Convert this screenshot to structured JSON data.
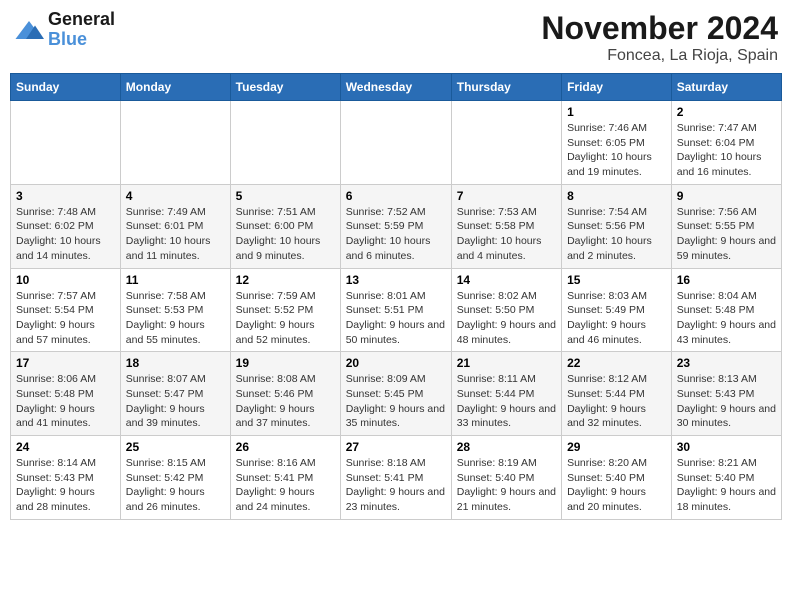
{
  "header": {
    "logo_general": "General",
    "logo_blue": "Blue",
    "month_title": "November 2024",
    "subtitle": "Foncea, La Rioja, Spain"
  },
  "days_of_week": [
    "Sunday",
    "Monday",
    "Tuesday",
    "Wednesday",
    "Thursday",
    "Friday",
    "Saturday"
  ],
  "weeks": [
    [
      {
        "day": "",
        "info": ""
      },
      {
        "day": "",
        "info": ""
      },
      {
        "day": "",
        "info": ""
      },
      {
        "day": "",
        "info": ""
      },
      {
        "day": "",
        "info": ""
      },
      {
        "day": "1",
        "info": "Sunrise: 7:46 AM\nSunset: 6:05 PM\nDaylight: 10 hours and 19 minutes."
      },
      {
        "day": "2",
        "info": "Sunrise: 7:47 AM\nSunset: 6:04 PM\nDaylight: 10 hours and 16 minutes."
      }
    ],
    [
      {
        "day": "3",
        "info": "Sunrise: 7:48 AM\nSunset: 6:02 PM\nDaylight: 10 hours and 14 minutes."
      },
      {
        "day": "4",
        "info": "Sunrise: 7:49 AM\nSunset: 6:01 PM\nDaylight: 10 hours and 11 minutes."
      },
      {
        "day": "5",
        "info": "Sunrise: 7:51 AM\nSunset: 6:00 PM\nDaylight: 10 hours and 9 minutes."
      },
      {
        "day": "6",
        "info": "Sunrise: 7:52 AM\nSunset: 5:59 PM\nDaylight: 10 hours and 6 minutes."
      },
      {
        "day": "7",
        "info": "Sunrise: 7:53 AM\nSunset: 5:58 PM\nDaylight: 10 hours and 4 minutes."
      },
      {
        "day": "8",
        "info": "Sunrise: 7:54 AM\nSunset: 5:56 PM\nDaylight: 10 hours and 2 minutes."
      },
      {
        "day": "9",
        "info": "Sunrise: 7:56 AM\nSunset: 5:55 PM\nDaylight: 9 hours and 59 minutes."
      }
    ],
    [
      {
        "day": "10",
        "info": "Sunrise: 7:57 AM\nSunset: 5:54 PM\nDaylight: 9 hours and 57 minutes."
      },
      {
        "day": "11",
        "info": "Sunrise: 7:58 AM\nSunset: 5:53 PM\nDaylight: 9 hours and 55 minutes."
      },
      {
        "day": "12",
        "info": "Sunrise: 7:59 AM\nSunset: 5:52 PM\nDaylight: 9 hours and 52 minutes."
      },
      {
        "day": "13",
        "info": "Sunrise: 8:01 AM\nSunset: 5:51 PM\nDaylight: 9 hours and 50 minutes."
      },
      {
        "day": "14",
        "info": "Sunrise: 8:02 AM\nSunset: 5:50 PM\nDaylight: 9 hours and 48 minutes."
      },
      {
        "day": "15",
        "info": "Sunrise: 8:03 AM\nSunset: 5:49 PM\nDaylight: 9 hours and 46 minutes."
      },
      {
        "day": "16",
        "info": "Sunrise: 8:04 AM\nSunset: 5:48 PM\nDaylight: 9 hours and 43 minutes."
      }
    ],
    [
      {
        "day": "17",
        "info": "Sunrise: 8:06 AM\nSunset: 5:48 PM\nDaylight: 9 hours and 41 minutes."
      },
      {
        "day": "18",
        "info": "Sunrise: 8:07 AM\nSunset: 5:47 PM\nDaylight: 9 hours and 39 minutes."
      },
      {
        "day": "19",
        "info": "Sunrise: 8:08 AM\nSunset: 5:46 PM\nDaylight: 9 hours and 37 minutes."
      },
      {
        "day": "20",
        "info": "Sunrise: 8:09 AM\nSunset: 5:45 PM\nDaylight: 9 hours and 35 minutes."
      },
      {
        "day": "21",
        "info": "Sunrise: 8:11 AM\nSunset: 5:44 PM\nDaylight: 9 hours and 33 minutes."
      },
      {
        "day": "22",
        "info": "Sunrise: 8:12 AM\nSunset: 5:44 PM\nDaylight: 9 hours and 32 minutes."
      },
      {
        "day": "23",
        "info": "Sunrise: 8:13 AM\nSunset: 5:43 PM\nDaylight: 9 hours and 30 minutes."
      }
    ],
    [
      {
        "day": "24",
        "info": "Sunrise: 8:14 AM\nSunset: 5:43 PM\nDaylight: 9 hours and 28 minutes."
      },
      {
        "day": "25",
        "info": "Sunrise: 8:15 AM\nSunset: 5:42 PM\nDaylight: 9 hours and 26 minutes."
      },
      {
        "day": "26",
        "info": "Sunrise: 8:16 AM\nSunset: 5:41 PM\nDaylight: 9 hours and 24 minutes."
      },
      {
        "day": "27",
        "info": "Sunrise: 8:18 AM\nSunset: 5:41 PM\nDaylight: 9 hours and 23 minutes."
      },
      {
        "day": "28",
        "info": "Sunrise: 8:19 AM\nSunset: 5:40 PM\nDaylight: 9 hours and 21 minutes."
      },
      {
        "day": "29",
        "info": "Sunrise: 8:20 AM\nSunset: 5:40 PM\nDaylight: 9 hours and 20 minutes."
      },
      {
        "day": "30",
        "info": "Sunrise: 8:21 AM\nSunset: 5:40 PM\nDaylight: 9 hours and 18 minutes."
      }
    ]
  ]
}
